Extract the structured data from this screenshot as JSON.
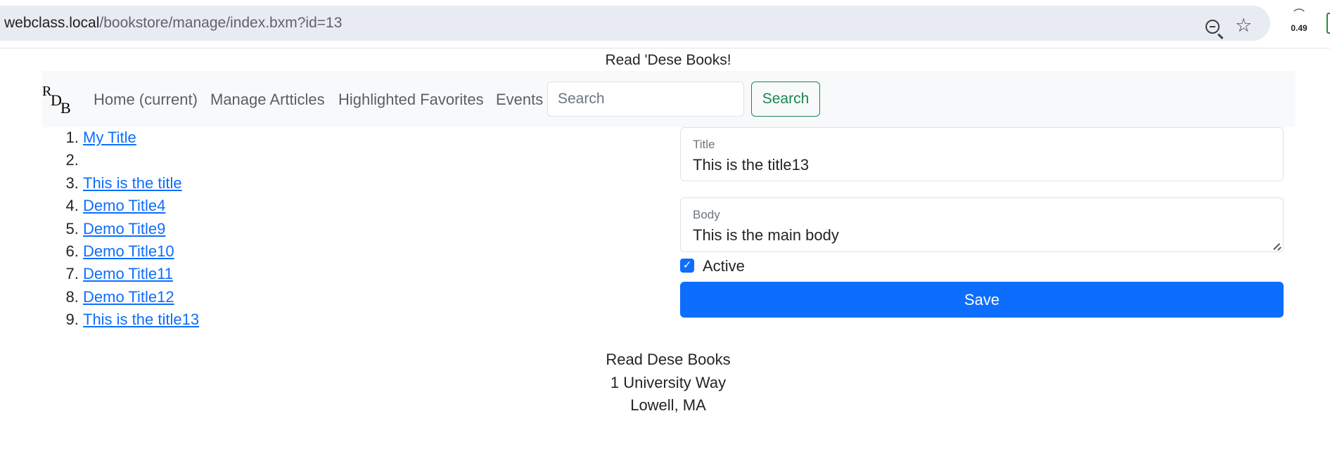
{
  "browser": {
    "url_host": "webclass.local",
    "url_path": "/bookstore/manage/index.bxm?id=13",
    "extension_value": "0.49",
    "icons": [
      "zoom-out-icon",
      "star-icon",
      "extension-icon"
    ]
  },
  "site": {
    "title": "Read 'Dese Books!",
    "brand_letters": [
      "R",
      "D",
      "B"
    ]
  },
  "nav": {
    "items": [
      {
        "label": "Home (current)"
      },
      {
        "label": "Manage Artticles"
      },
      {
        "label": "Highlighted Favorites"
      },
      {
        "label": "Events"
      }
    ],
    "search_placeholder": "Search",
    "search_button": "Search"
  },
  "articles": [
    {
      "title": "My Title"
    },
    {
      "title": ""
    },
    {
      "title": "This is the title"
    },
    {
      "title": "Demo Title4"
    },
    {
      "title": "Demo Title9"
    },
    {
      "title": "Demo Title10"
    },
    {
      "title": "Demo Title11"
    },
    {
      "title": "Demo Title12"
    },
    {
      "title": "This is the title13"
    }
  ],
  "form": {
    "title_label": "Title",
    "title_value": "This is the title13",
    "body_label": "Body",
    "body_value": "This is the main body",
    "active_label": "Active",
    "active_checked": true,
    "save_label": "Save"
  },
  "footer": {
    "name": "Read Dese Books",
    "street": "1 University Way",
    "city": "Lowell, MA"
  },
  "colors": {
    "primary": "#0d6efd",
    "success": "#198754",
    "navbar_bg": "#f8f9fa"
  }
}
